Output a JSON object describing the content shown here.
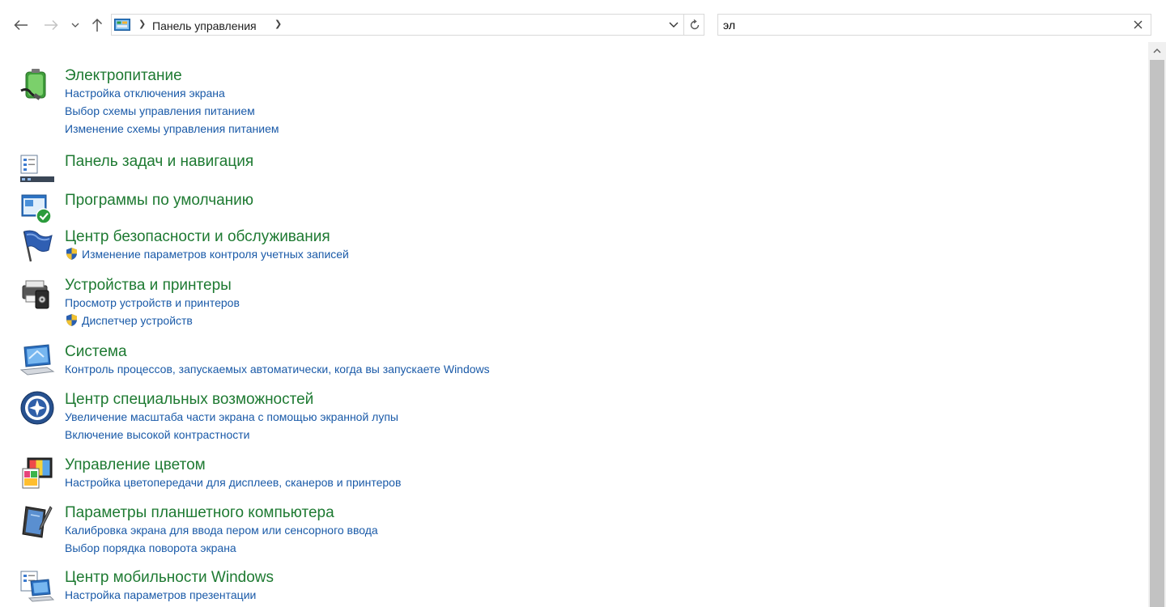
{
  "address": {
    "location": "Панель управления"
  },
  "search": {
    "value": "эл"
  },
  "results": [
    {
      "icon": "power-options-icon",
      "title": "Электропитание",
      "links": [
        {
          "text": "Настройка отключения экрана",
          "shield": false
        },
        {
          "text": "Выбор схемы управления питанием",
          "shield": false
        },
        {
          "text": "Изменение схемы управления питанием",
          "shield": false
        }
      ]
    },
    {
      "icon": "taskbar-icon",
      "title": "Панель задач и навигация",
      "links": []
    },
    {
      "icon": "default-programs-icon",
      "title": "Программы по умолчанию",
      "links": []
    },
    {
      "icon": "security-flag-icon",
      "title": "Центр безопасности и обслуживания",
      "links": [
        {
          "text": "Изменение параметров контроля учетных записей",
          "shield": true
        }
      ]
    },
    {
      "icon": "devices-printers-icon",
      "title": "Устройства и принтеры",
      "links": [
        {
          "text": "Просмотр устройств и принтеров",
          "shield": false
        },
        {
          "text": "Диспетчер устройств",
          "shield": true
        }
      ]
    },
    {
      "icon": "system-icon",
      "title": "Система",
      "links": [
        {
          "text": "Контроль процессов, запускаемых автоматически, когда вы запускаете Windows",
          "shield": false
        }
      ]
    },
    {
      "icon": "ease-of-access-icon",
      "title": "Центр специальных возможностей",
      "links": [
        {
          "text": "Увеличение масштаба части экрана с помощью экранной лупы",
          "shield": false
        },
        {
          "text": "Включение высокой контрастности",
          "shield": false
        }
      ]
    },
    {
      "icon": "color-management-icon",
      "title": "Управление цветом",
      "links": [
        {
          "text": "Настройка цветопередачи для дисплеев, сканеров и принтеров",
          "shield": false
        }
      ]
    },
    {
      "icon": "tablet-pc-icon",
      "title": "Параметры планшетного компьютера",
      "links": [
        {
          "text": "Калибровка экрана для ввода пером или сенсорного ввода",
          "shield": false
        },
        {
          "text": "Выбор порядка поворота экрана",
          "shield": false
        }
      ]
    },
    {
      "icon": "mobility-center-icon",
      "title": "Центр мобильности Windows",
      "links": [
        {
          "text": "Настройка параметров презентации",
          "shield": false
        }
      ]
    }
  ],
  "colors": {
    "title": "#1e7a32",
    "link": "#1a5aa8"
  }
}
